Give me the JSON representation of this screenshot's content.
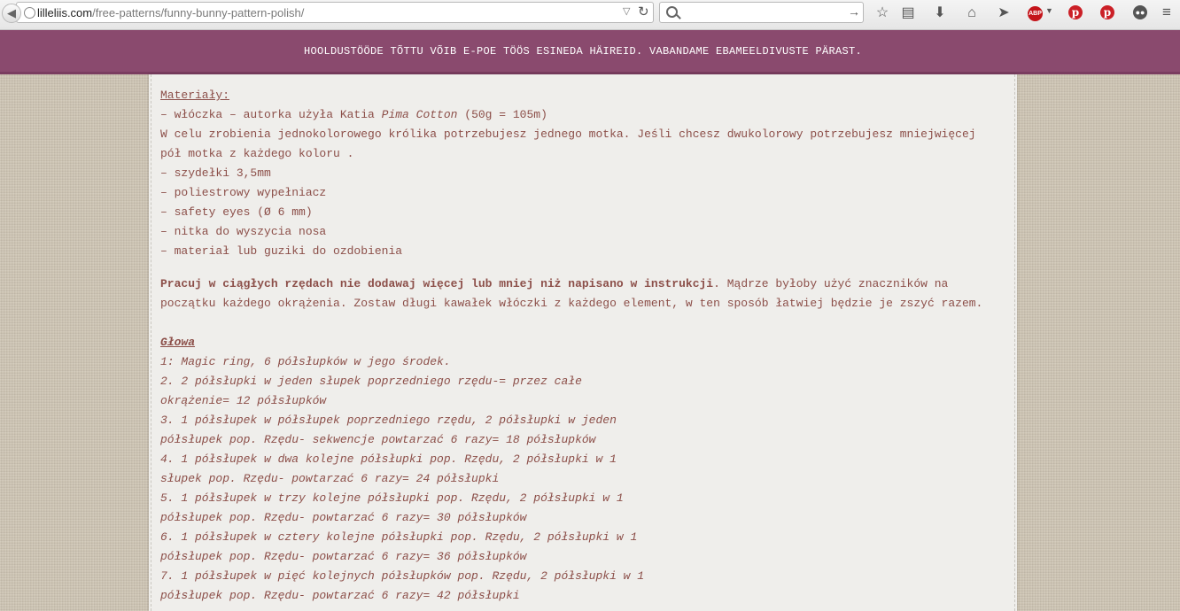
{
  "browser": {
    "url_host": "lilleliis.com",
    "url_path": "/free-patterns/funny-bunny-pattern-polish/"
  },
  "banner": {
    "text": "HOOLDUSTÖÖDE TÕTTU VÕIB E-POE TÖÖS ESINEDA HÄIREID. VABANDAME EBAMEELDIVUSTE PÄRAST."
  },
  "materials": {
    "heading": "Materiały:",
    "yarn_prefix": "– włóczka – autorka użyła Katia ",
    "yarn_brand": "Pima Cotton",
    "yarn_suffix": " (50g = 105m)",
    "intro_line1": "W celu zrobienia jednokolorowego królika potrzebujesz jednego motka. Jeśli chcesz dwukolorowy potrzebujesz mniejwięcej",
    "intro_line2": "pół motka z każdego koloru .",
    "items": [
      "– szydełki 3,5mm",
      "– poliestrowy wypełniacz",
      "– safety eyes (Ø 6 mm)",
      "– nitka do wyszycia nosa",
      "– materiał lub guziki do ozdobienia"
    ]
  },
  "instructions": {
    "bold_part": "Pracuj w ciągłych rzędach nie dodawaj więcej lub mniej niż napisano w instrukcji",
    "rest_line1": ". Mądrze byłoby użyć znaczników na",
    "line2": "początku każdego okrążenia. Zostaw długi kawałek włóczki z każdego element, w ten sposób łatwiej będzie je zszyć razem."
  },
  "head": {
    "heading": "Głowa",
    "lines": [
      "1: Magic ring, 6 półsłupków w jego środek.",
      "2. 2 półsłupki w jeden słupek poprzedniego rzędu-= przez całe",
      "okrążenie= 12 półsłupków",
      "3. 1 półsłupek w półsłupek poprzedniego rzędu, 2 półsłupki w jeden",
      "półsłupek pop. Rzędu- sekwencje powtarzać 6 razy= 18 półsłupków",
      "4. 1 półsłupek w dwa kolejne półsłupki pop. Rzędu, 2 półsłupki w 1",
      "słupek pop. Rzędu- powtarzać 6 razy= 24 półsłupki",
      "5. 1 półsłupek w trzy kolejne półsłupki pop. Rzędu, 2 półsłupki w 1",
      "półsłupek pop. Rzędu- powtarzać 6 razy= 30 półsłupków",
      "6. 1 półsłupek w cztery kolejne półsłupki pop. Rzędu, 2 półsłupki w 1",
      "półsłupek pop. Rzędu- powtarzać 6 razy= 36 półsłupków",
      "7. 1 półsłupek w pięć kolejnych półsłupków pop. Rzędu, 2 półsłupki w 1",
      "półsłupek pop. Rzędu- powtarzać 6 razy= 42 półsłupki"
    ]
  },
  "colors": {
    "banner": "#8a4a6e",
    "text": "#8c4f49",
    "panel": "#efeeeb"
  }
}
